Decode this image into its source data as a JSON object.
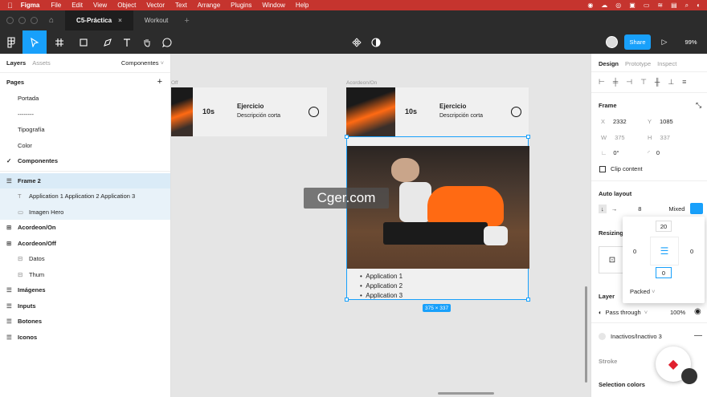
{
  "menubar": {
    "app": "Figma",
    "items": [
      "File",
      "Edit",
      "View",
      "Object",
      "Vector",
      "Text",
      "Arrange",
      "Plugins",
      "Window",
      "Help"
    ]
  },
  "tabs": {
    "active": "C5-Práctica",
    "other": "Workout",
    "add": "+"
  },
  "toolbar": {
    "share": "Share",
    "zoom": "99%"
  },
  "left": {
    "tab_layers": "Layers",
    "tab_assets": "Assets",
    "page_select": "Componentes",
    "pages_title": "Pages",
    "pages": [
      "Portada",
      "--------",
      "Tipografía",
      "Color",
      "Componentes"
    ],
    "layers": [
      {
        "label": "Frame 2",
        "bold": true,
        "icon": "frame",
        "indent": 0
      },
      {
        "label": "Application 1 Application 2 Application 3",
        "bold": false,
        "icon": "text",
        "indent": 1
      },
      {
        "label": "Imagen Hero",
        "bold": false,
        "icon": "image",
        "indent": 1
      },
      {
        "label": "Acordeon/On",
        "bold": true,
        "icon": "component",
        "indent": 0
      },
      {
        "label": "Acordeon/Off",
        "bold": true,
        "icon": "component",
        "indent": 0
      },
      {
        "label": "Datos",
        "bold": false,
        "icon": "auto-layout",
        "indent": 1
      },
      {
        "label": "Thum",
        "bold": false,
        "icon": "auto-layout",
        "indent": 1
      },
      {
        "label": "Imágenes",
        "bold": true,
        "icon": "frame",
        "indent": 0
      },
      {
        "label": "Inputs",
        "bold": true,
        "icon": "frame",
        "indent": 0
      },
      {
        "label": "Botones",
        "bold": true,
        "icon": "frame",
        "indent": 0
      },
      {
        "label": "Iconos",
        "bold": true,
        "icon": "frame",
        "indent": 0
      }
    ]
  },
  "canvas": {
    "frame_off_label": "Off",
    "frame_on_label": "Acordeon/On",
    "time": "10s",
    "exercise_title": "Ejercicio",
    "exercise_desc": "Descripción corta",
    "bullets": [
      "Application 1",
      "Application 2",
      "Application 3"
    ],
    "size_badge": "375 × 337",
    "watermark": "Cger.com"
  },
  "right": {
    "tab_design": "Design",
    "tab_prototype": "Prototype",
    "tab_inspect": "Inspect",
    "frame_title": "Frame",
    "x_label": "X",
    "x_value": "2332",
    "y_label": "Y",
    "y_value": "1085",
    "w_label": "W",
    "w_value": "375",
    "h_label": "H",
    "h_value": "337",
    "rotation": "0°",
    "radius": "0",
    "clip_content": "Clip content",
    "auto_layout": "Auto layout",
    "spacing": "8",
    "mixed": "Mixed",
    "resizing": "Resizing",
    "pad_top": "20",
    "pad_left": "0",
    "pad_right": "0",
    "pad_bottom": "0",
    "packed": "Packed",
    "layer_title": "Layer",
    "pass_through": "Pass through",
    "opacity": "100%",
    "style": "Inactivos/Inactivo 3",
    "stroke": "Stroke",
    "selection_colors": "Selection colors"
  },
  "colors": {
    "menubar": "#c5342e",
    "accent": "#18a0fb",
    "dark": "#2c2c2c",
    "orange": "#ff6a13"
  }
}
